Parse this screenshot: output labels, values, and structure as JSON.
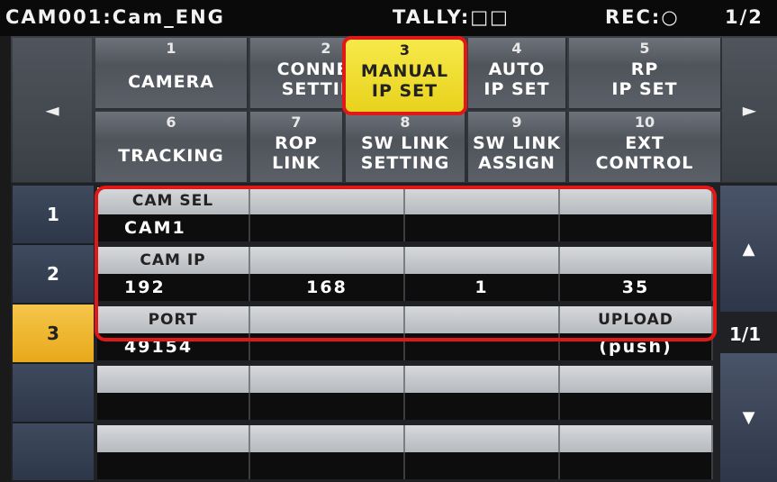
{
  "status": {
    "cam": "CAM001:Cam_ENG",
    "tally": "TALLY:□□",
    "rec": "REC:○",
    "page": "1/2"
  },
  "nav": {
    "prev_icon": "◄",
    "next_icon": "►"
  },
  "menu": [
    {
      "num": "1",
      "label": "CAMERA"
    },
    {
      "num": "2",
      "label": "CONNECT\nSETTING"
    },
    {
      "num": "3",
      "label": "MANUAL\nIP SET"
    },
    {
      "num": "4",
      "label": "AUTO\nIP SET"
    },
    {
      "num": "5",
      "label": "RP\nIP SET"
    },
    {
      "num": "6",
      "label": "TRACKING"
    },
    {
      "num": "7",
      "label": "ROP\nLINK"
    },
    {
      "num": "8",
      "label": "SW LINK\nSETTING"
    },
    {
      "num": "9",
      "label": "SW LINK\nASSIGN"
    },
    {
      "num": "10",
      "label": "EXT\nCONTROL"
    }
  ],
  "rows": [
    {
      "num": "1",
      "label": "CAM SEL",
      "values": [
        "CAM1",
        "",
        "",
        ""
      ]
    },
    {
      "num": "2",
      "label": "CAM IP",
      "values": [
        "192",
        "168",
        "1",
        "35"
      ]
    },
    {
      "num": "3",
      "label": "PORT",
      "values": [
        "49154",
        "",
        "",
        "(push)"
      ],
      "extra_label": "UPLOAD"
    }
  ],
  "scroll": {
    "up_icon": "▲",
    "down_icon": "▼",
    "page": "1/1"
  }
}
